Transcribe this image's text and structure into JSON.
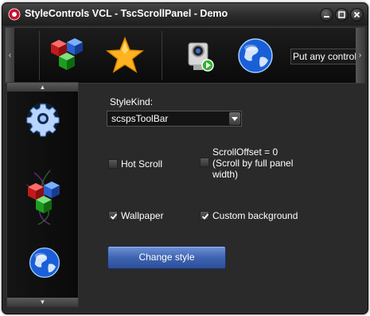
{
  "window": {
    "title": "StyleControls VCL - TscScrollPanel - Demo",
    "app_icon": "app-logo-icon",
    "buttons": [
      "minimize-icon",
      "maximize-icon",
      "close-icon"
    ]
  },
  "top_panel": {
    "icons": [
      "color-cubes-icon",
      "star-icon",
      "webcam-icon",
      "globe-icon"
    ],
    "text_item": "Put any control"
  },
  "left_panel": {
    "icons": [
      "gear-icon",
      "color-cubes-icon",
      "globe-icon"
    ]
  },
  "main": {
    "style_kind_label": "StyleKind:",
    "style_kind_value": "scspsToolBar",
    "hot_scroll_label": "Hot Scroll",
    "hot_scroll_checked": false,
    "scroll_offset_line1": "ScrollOffset = 0",
    "scroll_offset_line2": "(Scroll by full panel",
    "scroll_offset_line3": "width)",
    "scroll_offset_checked": false,
    "wallpaper_label": "Wallpaper",
    "wallpaper_checked": true,
    "custom_bg_label": "Custom background",
    "custom_bg_checked": true,
    "change_style_label": "Change style"
  },
  "colors": {
    "window_bg": "#2a2a2a",
    "accent_button": "#3f64b2"
  }
}
